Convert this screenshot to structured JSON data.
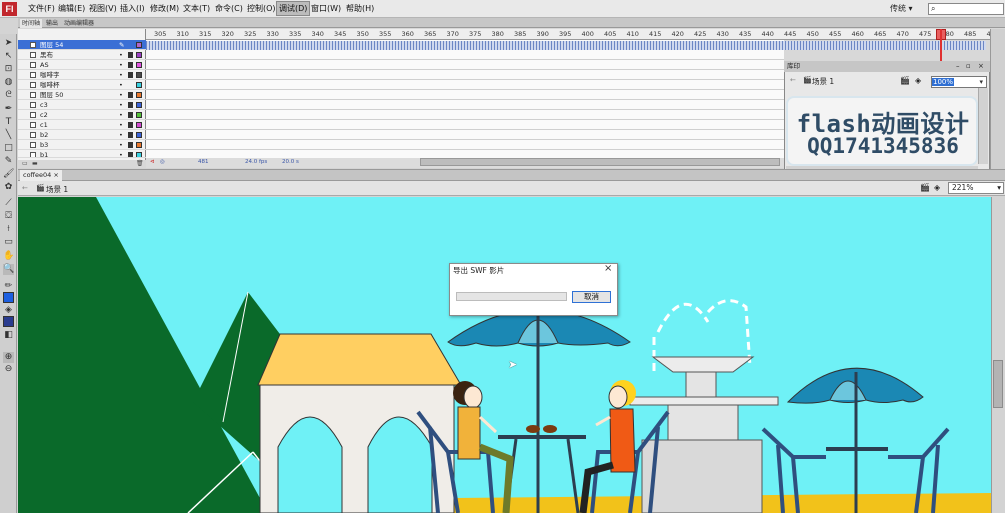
{
  "app": {
    "logo": "Fl"
  },
  "menu": [
    {
      "label": "文件(F)"
    },
    {
      "label": "编辑(E)"
    },
    {
      "label": "视图(V)"
    },
    {
      "label": "插入(I)"
    },
    {
      "label": "修改(M)"
    },
    {
      "label": "文本(T)"
    },
    {
      "label": "命令(C)"
    },
    {
      "label": "控制(O)"
    },
    {
      "label": "调试(D)"
    },
    {
      "label": "窗口(W)"
    },
    {
      "label": "帮助(H)"
    }
  ],
  "workspace": "传统",
  "search": {
    "value": "",
    "placeholder": ""
  },
  "timeline": {
    "tabs": [
      "时间轴",
      "输出",
      "动画编辑器"
    ],
    "layers": [
      {
        "name": "图层 54"
      },
      {
        "name": "黑布"
      },
      {
        "name": "AS"
      },
      {
        "name": "咖啡字"
      },
      {
        "name": "咖啡杯"
      },
      {
        "name": "图层 50"
      },
      {
        "name": "c3"
      },
      {
        "name": "c2"
      },
      {
        "name": "c1"
      },
      {
        "name": "b2"
      },
      {
        "name": "b3"
      },
      {
        "name": "b1"
      }
    ],
    "ruler": [
      "305",
      "310",
      "315",
      "320",
      "325",
      "330",
      "335",
      "340",
      "345",
      "350",
      "355",
      "360",
      "365",
      "370",
      "375",
      "380",
      "385",
      "390",
      "395",
      "400",
      "405",
      "410",
      "415",
      "420",
      "425",
      "430",
      "435",
      "440",
      "445",
      "450",
      "455",
      "460",
      "465",
      "470",
      "475",
      "480",
      "485",
      "490"
    ],
    "current_frame": "481",
    "fps": "24.0 fps",
    "elapsed": "20.0 s"
  },
  "library_panel": {
    "title": "库印",
    "scene": "场景 1",
    "zoom": "100%",
    "banner_line1": "flash动画设计",
    "banner_line2": "QQ1741345836"
  },
  "document": {
    "tab": "coffee04",
    "tab_close": "×",
    "scene": "场景 1",
    "zoom": "221%"
  },
  "dialog": {
    "title": "导出 SWF 影片",
    "close": "×",
    "progress": 0.0,
    "cancel_label": "取消"
  },
  "colors": {
    "sky": "#6ff1f6",
    "mountain": "#0a6a2a",
    "umbrella": "#1b88b4",
    "ground": "#f2c21a",
    "selected_layer": "#3b6fd5"
  }
}
